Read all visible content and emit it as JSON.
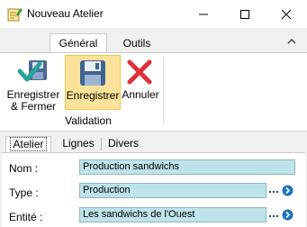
{
  "window": {
    "title": "Nouveau Atelier",
    "icon": "notepad-pencil-icon",
    "controls": [
      "minimize-icon",
      "maximize-icon",
      "close-icon"
    ]
  },
  "ribbon": {
    "tabs": [
      {
        "label": "Général",
        "active": true
      },
      {
        "label": "Outils",
        "active": false
      }
    ],
    "buttons": {
      "save_close": {
        "line1": "Enregistrer",
        "line2": "& Fermer",
        "icon": "save-check-icon"
      },
      "save": {
        "label": "Enregistrer",
        "icon": "floppy-disk-icon",
        "highlighted": true
      },
      "cancel": {
        "label": "Annuler",
        "icon": "red-x-icon"
      }
    },
    "group_label": "Validation"
  },
  "sub_tabs": [
    {
      "label": "Atelier",
      "active": true
    },
    {
      "label": "Lignes",
      "active": false
    },
    {
      "label": "Divers",
      "active": false
    }
  ],
  "form": {
    "nom": {
      "label": "Nom :",
      "value": "Production sandwichs"
    },
    "type": {
      "label": "Type :",
      "value": "Production"
    },
    "entite": {
      "label": "Entité :",
      "value": "Les sandwichs de l'Ouest"
    }
  },
  "colors": {
    "field_bg": "#bfe3ea",
    "highlight_bg": "#fbe29a",
    "accent_blue": "#1e73be"
  }
}
